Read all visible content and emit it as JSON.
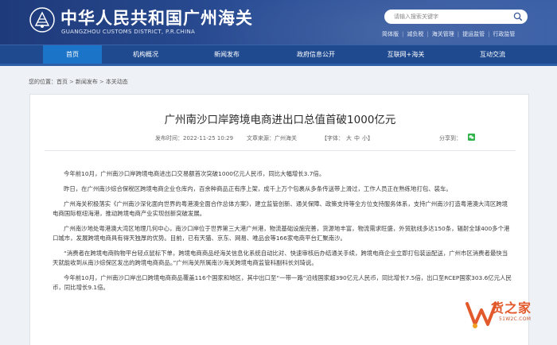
{
  "header": {
    "title": "中华人民共和国广州海关",
    "subtitle": "GUANGZHOU CUSTOMS DISTRICT, P.R.CHINA",
    "search_placeholder": "请输入搜索关键字",
    "quick_links": [
      "简体版",
      "减负税",
      "海关管理",
      "提运监管",
      "行政监管"
    ]
  },
  "nav": {
    "items": [
      "首页",
      "机构概况",
      "新闻发布",
      "政府信息公开",
      "互联网+海关",
      "互动交流"
    ],
    "active_index": 0
  },
  "breadcrumb": {
    "prefix": "您的位置：",
    "items": [
      "首页",
      "新闻发布",
      "本关动态"
    ]
  },
  "article": {
    "title": "广州南沙口岸跨境电商进出口总值首破1000亿元",
    "publish_time": "发布时间：2022-11-25 10:29",
    "source": "文章来源：广州海关",
    "font_size_label": "【字体：",
    "font_sizes": [
      "大",
      "中",
      "小"
    ],
    "font_size_close": "】",
    "share_label": "分享到：",
    "paragraphs": [
      "今年前10月，广州南沙口岸跨境电商进出口交易额首次突破1000亿元人民币，同比大幅增长3.7倍。",
      "昨日，在广州南沙综合保税区跨境电商企业仓库内，百余种商品正有序上架，成千上万个包裹从多条传送带上滑过，工作人员正在熟练地打包、装车。",
      "广州海关积极落实《广州南沙深化面向世界的粤港澳全面合作总体方案》，建立监管创新、通关保障、政策支持等全方位支持服务体系，支持广州南沙打造粤港澳大湾区跨境电商国际枢纽海港，推动跨境电商产业实现创新突破发展。",
      "广州南沙地处粤港澳大湾区地理几何中心，南沙口岸位于世界第三大港广州港，物流基础设施完善，货源地丰富，物流需求旺盛，外贸航线多达150条，辐射全球400多个港口城市，发展跨境电商具有得天独厚的优势。目前，已有天猫、京东、网易、唯品会等166家电商平台汇聚南沙。",
      "“消费者在跨境电商购物平台轻点鼠标下单，跨境电商商品经海关信息化系统自动比对、快速审核后办结通关手续，跨境电商企业立即打包装运配送，广州市区消费者最快当天就能收到从南沙综保区发出的跨境电商商品。”广州海关所属南沙海关跨境电商监管科副科长刘琦说。",
      "今年前10月，广州南沙口岸出口跨境电商商品覆盖116个国家和地区，其中出口至“一带一路”沿线国家超390亿元人民币，同比增长7.5倍，出口至RCEP国家303.6亿元人民币，同比增长9.1倍。"
    ]
  },
  "watermark": {
    "text": "货之家",
    "url": "51W2C.COM"
  },
  "colors": {
    "header_bg": "#1e3a7a",
    "nav_bg": "#1f4a8f",
    "nav_active": "#1b74c8",
    "watermark": "#e25a2c"
  }
}
